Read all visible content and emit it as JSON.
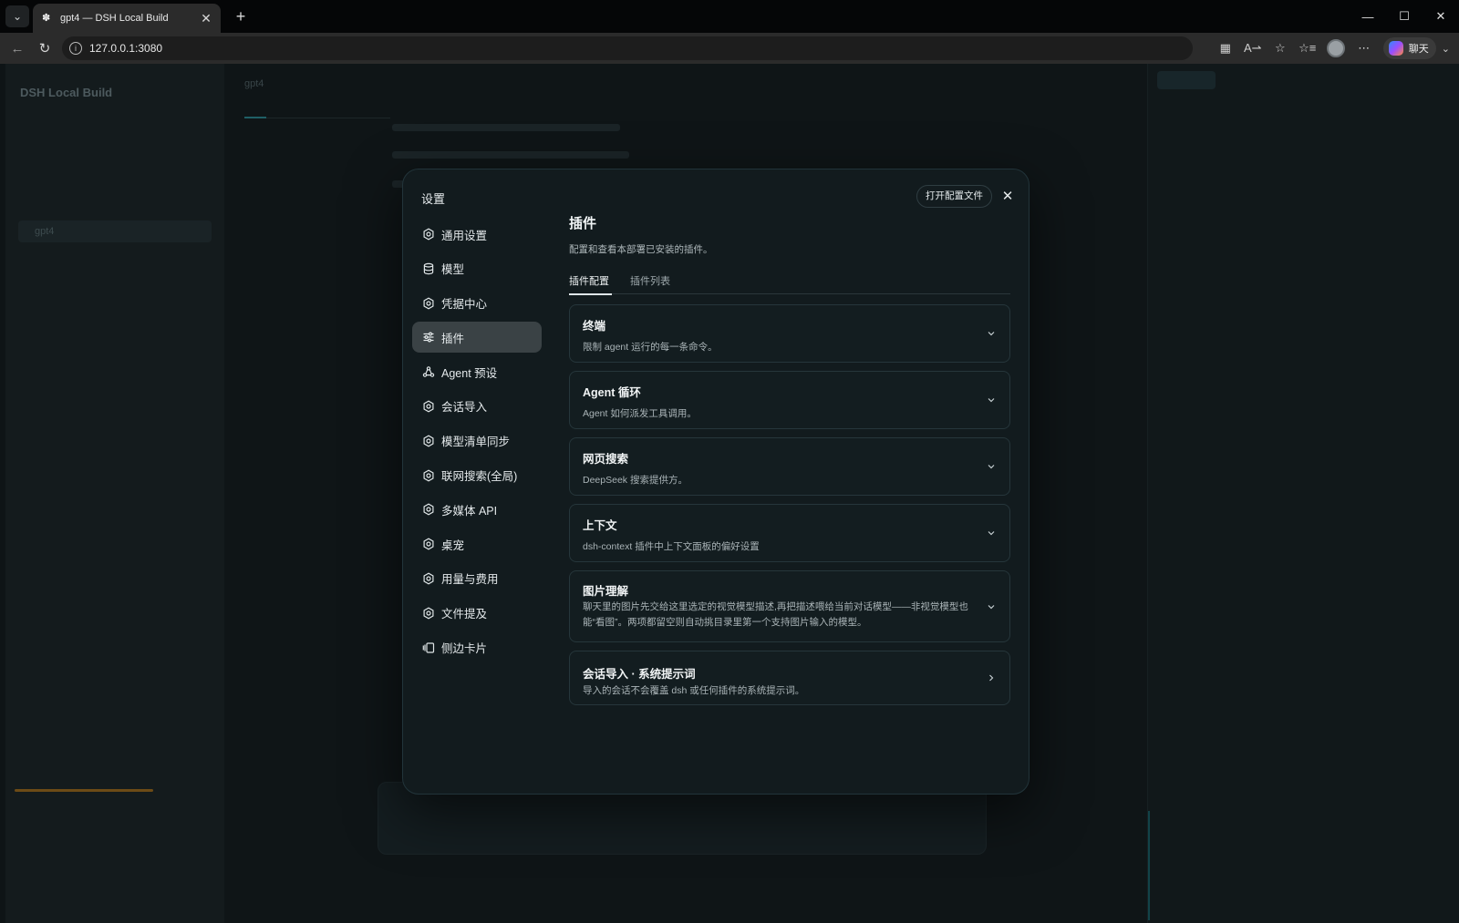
{
  "browser": {
    "tab_title": "gpt4 — DSH Local Build",
    "url": "127.0.0.1:3080",
    "copilot_label": "聊天"
  },
  "background": {
    "brand": "DSH Local Build",
    "conversation": "gpt4"
  },
  "settings": {
    "title": "设置",
    "open_config_label": "打开配置文件",
    "nav": [
      {
        "label": "通用设置",
        "icon": "gear-icon"
      },
      {
        "label": "模型",
        "icon": "database-icon"
      },
      {
        "label": "凭据中心",
        "icon": "gear-icon"
      },
      {
        "label": "插件",
        "icon": "sliders-icon",
        "active": true
      },
      {
        "label": "Agent 预设",
        "icon": "agent-icon"
      },
      {
        "label": "会话导入",
        "icon": "gear-icon"
      },
      {
        "label": "模型清单同步",
        "icon": "gear-icon"
      },
      {
        "label": "联网搜索(全局)",
        "icon": "gear-icon"
      },
      {
        "label": "多媒体 API",
        "icon": "gear-icon"
      },
      {
        "label": "桌宠",
        "icon": "gear-icon"
      },
      {
        "label": "用量与费用",
        "icon": "gear-icon"
      },
      {
        "label": "文件提及",
        "icon": "gear-icon"
      },
      {
        "label": "侧边卡片",
        "icon": "side-cards-icon"
      }
    ],
    "content": {
      "title": "插件",
      "description": "配置和查看本部署已安装的插件。",
      "tabs": [
        "插件配置",
        "插件列表"
      ],
      "active_tab": 0,
      "cards": [
        {
          "title": "终端",
          "description": "限制 agent 运行的每一条命令。",
          "chevron": "down"
        },
        {
          "title": "Agent 循环",
          "description": "Agent 如何派发工具调用。",
          "chevron": "down"
        },
        {
          "title": "网页搜索",
          "description": "DeepSeek 搜索提供方。",
          "chevron": "down"
        },
        {
          "title": "上下文",
          "description": "dsh-context 插件中上下文面板的偏好设置",
          "chevron": "down"
        },
        {
          "title": "图片理解",
          "description": "聊天里的图片先交给这里选定的视觉模型描述,再把描述喂给当前对话模型——非视觉模型也能“看图”。两项都留空则自动挑目录里第一个支持图片输入的模型。",
          "chevron": "down"
        },
        {
          "title": "会话导入 · 系统提示词",
          "description": "导入的会话不会覆盖 dsh 或任何插件的系统提示词。",
          "chevron": "right"
        }
      ]
    }
  }
}
